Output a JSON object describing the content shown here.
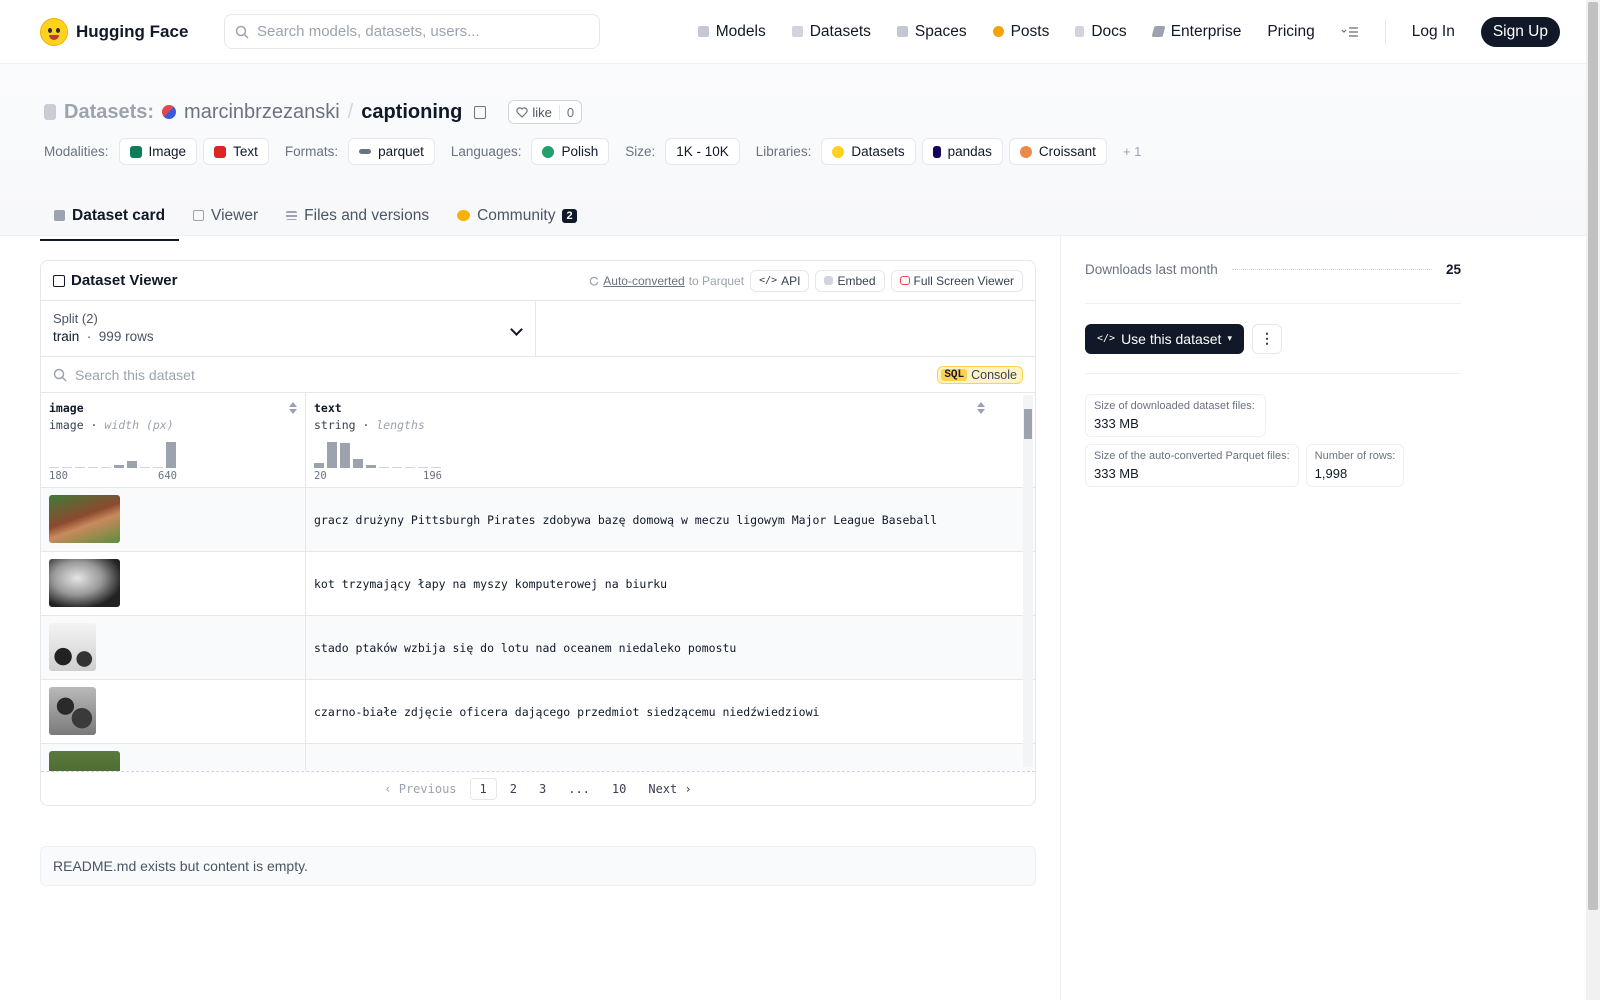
{
  "nav": {
    "brand": "Hugging Face",
    "search_placeholder": "Search models, datasets, users...",
    "links": [
      "Models",
      "Datasets",
      "Spaces",
      "Posts",
      "Docs",
      "Enterprise",
      "Pricing"
    ],
    "login": "Log In",
    "signup": "Sign Up"
  },
  "header": {
    "prefix": "Datasets:",
    "owner": "marcinbrzezanski",
    "name": "captioning",
    "like_label": "like",
    "like_count": "0",
    "modalities_label": "Modalities:",
    "modalities": [
      "Image",
      "Text"
    ],
    "formats_label": "Formats:",
    "format": "parquet",
    "languages_label": "Languages:",
    "language": "Polish",
    "size_label": "Size:",
    "size": "1K - 10K",
    "libraries_label": "Libraries:",
    "libraries": [
      "Datasets",
      "pandas",
      "Croissant"
    ],
    "more_libraries": "+ 1"
  },
  "tabs": {
    "card": "Dataset card",
    "viewer": "Viewer",
    "files": "Files and versions",
    "community": "Community",
    "community_count": "2"
  },
  "viewer": {
    "title": "Dataset Viewer",
    "auto_converted": "Auto-converted",
    "to_parquet": "to Parquet",
    "api": "API",
    "embed": "Embed",
    "fullscreen": "Full Screen Viewer",
    "split_label": "Split (2)",
    "split_value": "train",
    "split_rows": "999 rows",
    "search_placeholder": "Search this dataset",
    "sql": "SQL",
    "console": "Console",
    "columns": [
      {
        "name": "image",
        "type": "image",
        "stat": "width (px)",
        "min": "180",
        "max": "640",
        "hist": [
          0,
          0,
          0,
          0,
          0,
          0.1,
          0.25,
          0,
          0,
          1
        ]
      },
      {
        "name": "text",
        "type": "string",
        "stat": "lengths",
        "min": "20",
        "max": "196",
        "hist": [
          0.2,
          1,
          0.95,
          0.35,
          0.1,
          0,
          0,
          0,
          0,
          0
        ]
      }
    ],
    "rows": [
      "gracz drużyny Pittsburgh Pirates zdobywa bazę domową w meczu ligowym Major League Baseball",
      "kot trzymający łapy na myszy komputerowej na biurku",
      "stado ptaków wzbija się do lotu nad oceanem niedaleko pomostu",
      "czarno-białe zdjęcie oficera dającego przedmiot siedzącemu niedźwiedziowi",
      ""
    ],
    "pager": {
      "prev": "Previous",
      "pages": [
        "1",
        "2",
        "3",
        "...",
        "10"
      ],
      "next": "Next"
    }
  },
  "readme_text": "README.md exists but content is empty.",
  "sidebar": {
    "downloads_label": "Downloads last month",
    "downloads": "25",
    "use_button": "Use this dataset",
    "stats": [
      {
        "label": "Size of downloaded dataset files:",
        "value": "333 MB"
      },
      {
        "label": "Size of the auto-converted Parquet files:",
        "value": "333 MB"
      },
      {
        "label": "Number of rows:",
        "value": "1,998"
      }
    ]
  }
}
